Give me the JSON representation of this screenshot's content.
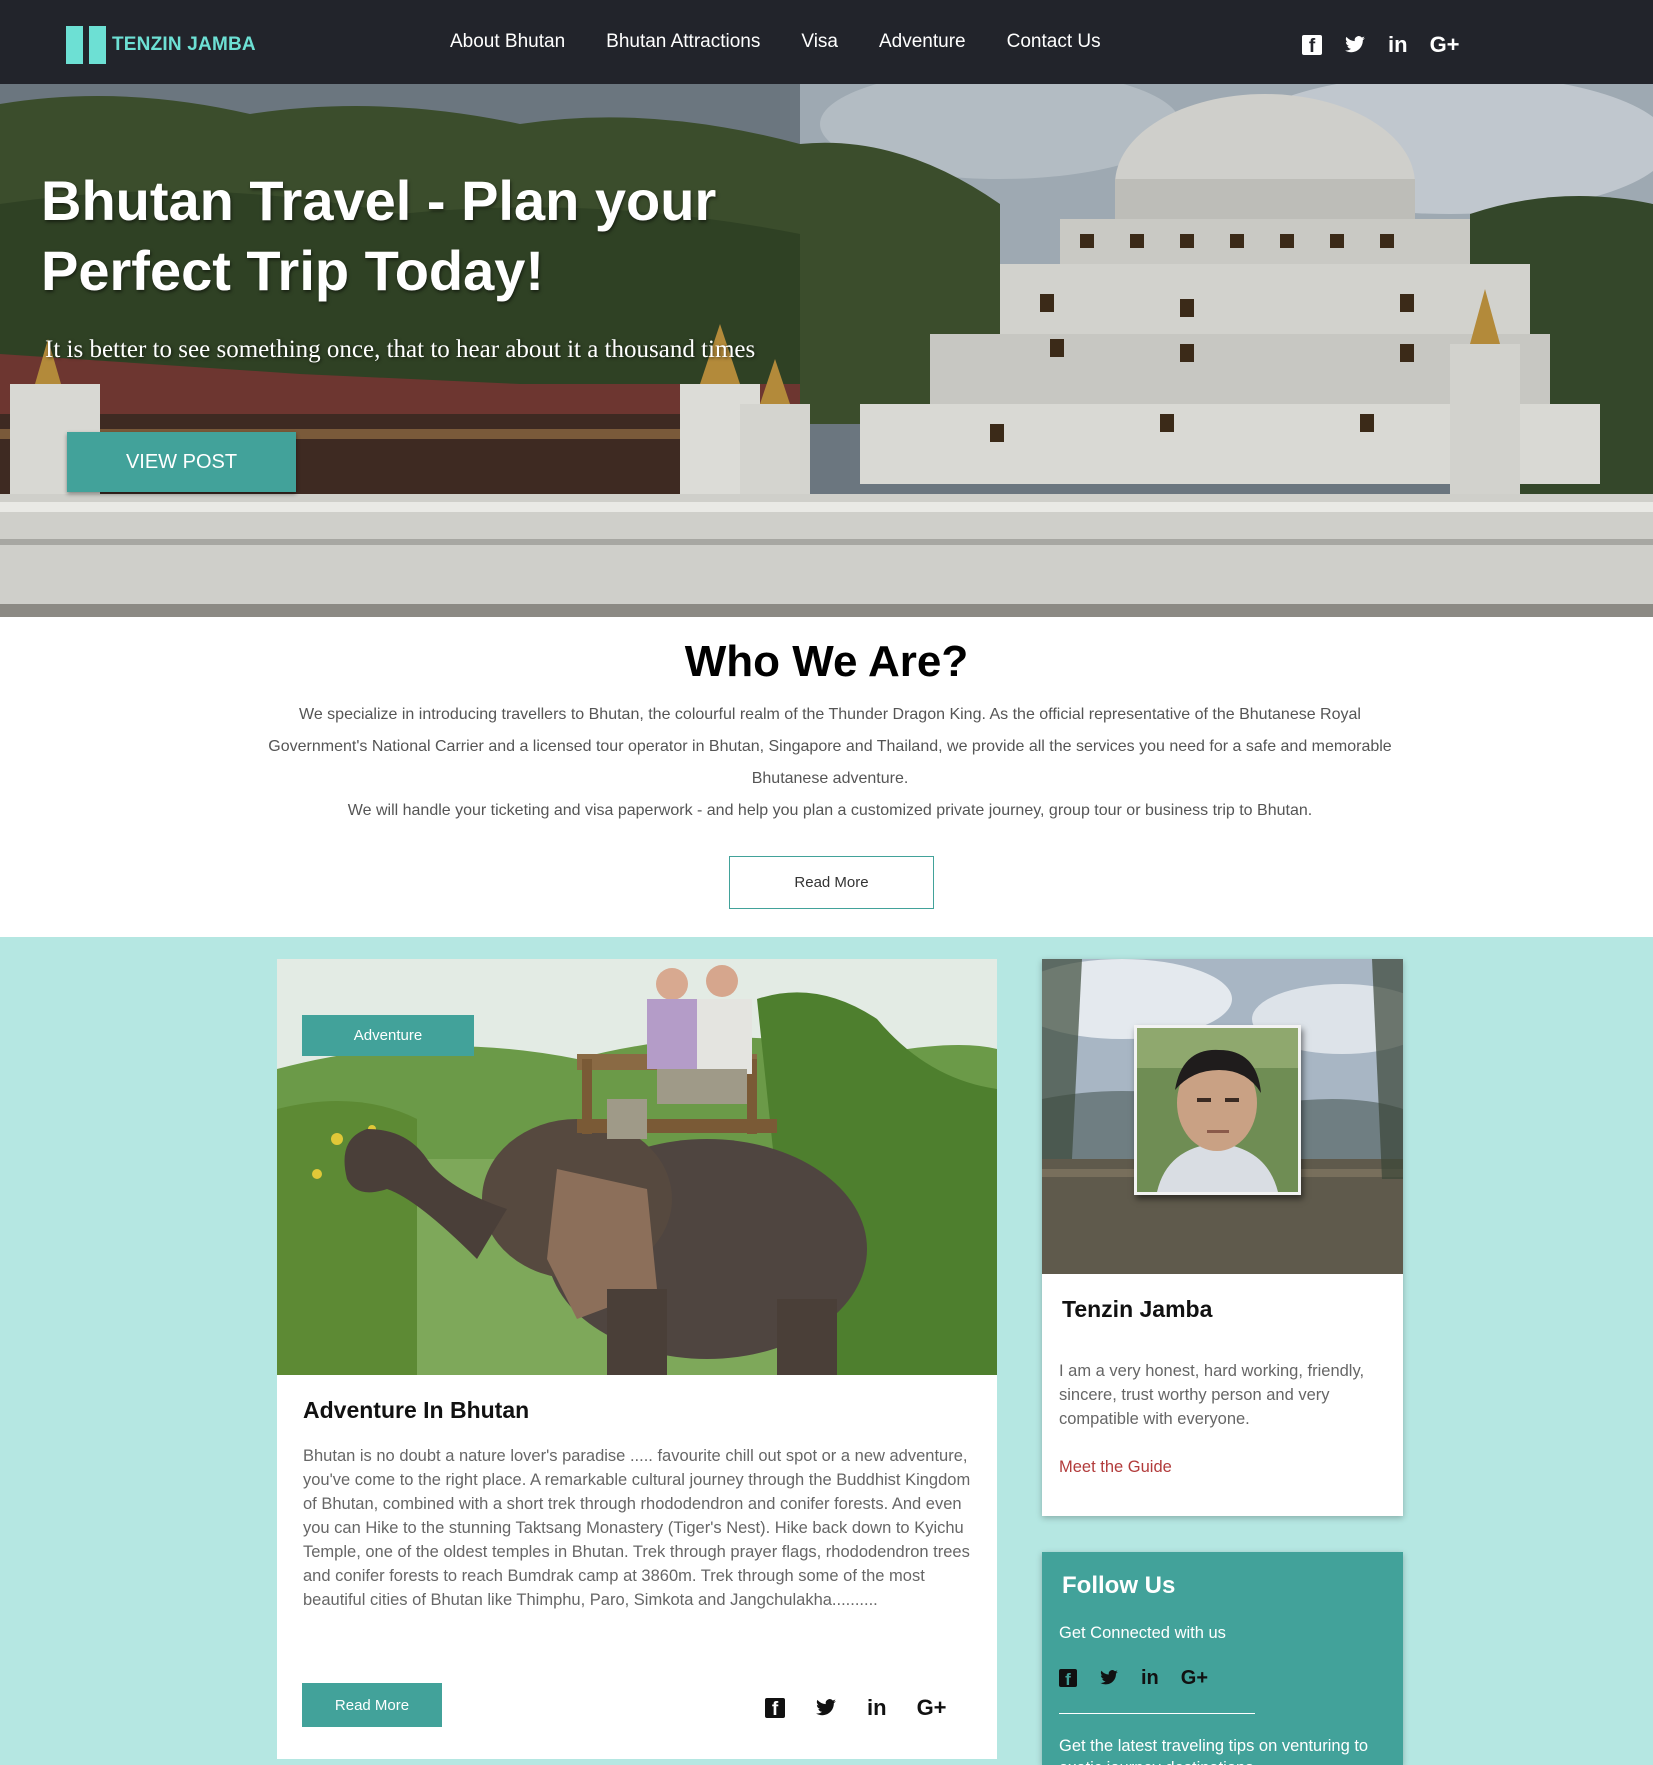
{
  "nav": {
    "brand": "TENZIN JAMBA",
    "links": [
      "About Bhutan",
      "Bhutan Attractions",
      "Visa",
      "Adventure",
      "Contact Us"
    ],
    "social": [
      "f",
      "t",
      "in",
      "G+"
    ]
  },
  "hero": {
    "title": "Bhutan Travel - Plan your Perfect Trip Today!",
    "subtitle": "It is better to see something once, that to hear about it a thousand times",
    "button": "VIEW POST"
  },
  "who": {
    "heading": "Who We Are?",
    "paragraph1": "We specialize in introducing travellers to Bhutan, the colourful realm of the Thunder Dragon King. As the official representative of the Bhutanese Royal Government's National Carrier and a licensed tour operator in Bhutan, Singapore and Thailand, we provide all the services you need for a safe and memorable Bhutanese adventure.",
    "paragraph2": "We will handle your ticketing and visa paperwork - and help you plan a customized private journey, group tour or business trip to Bhutan.",
    "button": "Read More"
  },
  "post": {
    "tag": "Adventure",
    "title": "Adventure In Bhutan",
    "body": "Bhutan is no doubt a nature lover's paradise ..... favourite chill out spot or a new adventure, you've come to the right place. A remarkable cultural journey through the Buddhist Kingdom of Bhutan, combined with a short trek through rhododendron and conifer forests. And even you can Hike to the stunning Taktsang Monastery (Tiger's Nest). Hike back down to Kyichu Temple, one of the oldest temples in Bhutan. Trek through prayer flags, rhododendron trees and conifer forests to reach Bumdrak camp at 3860m. Trek through some of the most beautiful cities of Bhutan like Thimphu, Paro, Simkota and Jangchulakha..........",
    "button": "Read More",
    "social": [
      "f",
      "t",
      "in",
      "G+"
    ]
  },
  "guide": {
    "name": "Tenzin Jamba",
    "description": "I am a very honest, hard working, friendly, sincere, trust worthy person and very compatible with everyone.",
    "link": "Meet the Guide"
  },
  "follow": {
    "title": "Follow Us",
    "subtitle": "Get Connected with us",
    "social": [
      "f",
      "t",
      "in",
      "G+"
    ],
    "tips": "Get the latest traveling tips on venturing to exotic journey destinations"
  },
  "colors": {
    "accent": "#42a29a",
    "logo": "#6de0d4",
    "nav_bg": "#22242b",
    "page_bg": "#b5e7e2",
    "link_red": "#b23b3b"
  }
}
